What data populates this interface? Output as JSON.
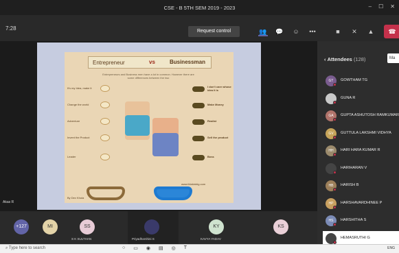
{
  "window": {
    "title": "CSE - B 5TH SEM 2019 - 2023"
  },
  "toolbar": {
    "time": "7:28",
    "request_control": "Request control"
  },
  "slide": {
    "heading_left": "Entrepreneur",
    "heading_vs": "vs",
    "heading_right": "Businessman",
    "subtitle": "Entrepreneurs and Business men have a lot in common. However there are some differences between the two",
    "left_rows": [
      "It's my Idea, make it",
      "Change the world",
      "Adventure",
      "Invent the Product",
      "Leader"
    ],
    "right_rows": [
      "I don't care whose idea it is",
      "Make Money",
      "Realist",
      "Sell the product",
      "Boss"
    ],
    "footer_left": "By Dev Khola",
    "footer_right": "www.thinkinbig.com"
  },
  "stage_label": "Akas R",
  "attendees": {
    "header": "Attendees",
    "count": "(128)",
    "button": "Ma",
    "items": [
      {
        "initials": "GT",
        "name": "GOWTHAM TG",
        "color": "#7a5c8f"
      },
      {
        "initials": "",
        "name": "GUNA R",
        "color": "#c9c9c9"
      },
      {
        "initials": "GA",
        "name": "GUPTA ASHUTOSH RAMKUMAR",
        "color": "#b0736a"
      },
      {
        "initials": "GV",
        "name": "GUTTULA LAKSHMI VIDHYA",
        "color": "#c6a45a"
      },
      {
        "initials": "HH",
        "name": "HARI HARA KUMAR R",
        "color": "#9b8a6c"
      },
      {
        "initials": "",
        "name": "HARIHARAN V",
        "color": "#444444"
      },
      {
        "initials": "HB",
        "name": "HARISH B",
        "color": "#9c7f5a"
      },
      {
        "initials": "HP",
        "name": "HARSHAVARDHINEE P",
        "color": "#c8a060"
      },
      {
        "initials": "HS",
        "name": "HARSHITHA S",
        "color": "#7b8bb6"
      },
      {
        "initials": "",
        "name": "HEMASRUTHI G",
        "color": "#444444"
      }
    ]
  },
  "participants": [
    {
      "initials": "+127",
      "label": "",
      "color": "#6264a7"
    },
    {
      "initials": "MI",
      "label": "",
      "color": "#e3d3a8"
    },
    {
      "initials": "SS",
      "label": "S K SULTHAN",
      "color": "#e7cbd6"
    },
    {
      "initials": "",
      "label": "Priyadharshini S",
      "color": "#3a3a6a"
    },
    {
      "initials": "KY",
      "label": "KAVYA YADAV",
      "color": "#cfe3cf"
    },
    {
      "initials": "KS",
      "label": "",
      "color": "#ead0d8"
    }
  ],
  "taskbar": {
    "search": "Type here to search",
    "tray": "ENG"
  }
}
